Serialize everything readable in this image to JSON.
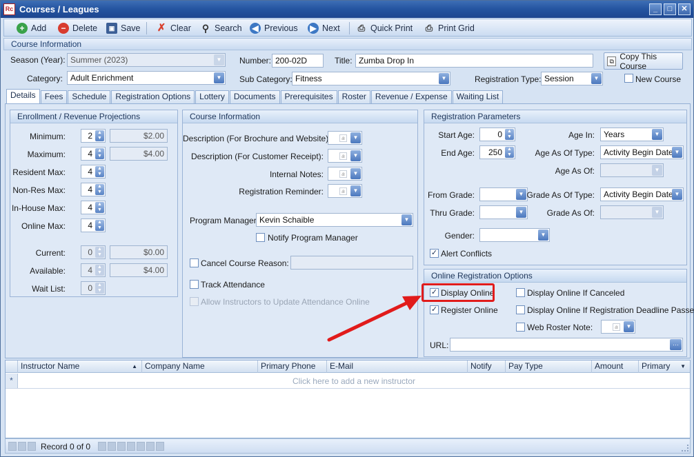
{
  "window": {
    "app_icon_text": "Rc",
    "title": "Courses / Leagues",
    "min": "_",
    "max": "□",
    "close": "✕"
  },
  "toolbar": {
    "add": "Add",
    "delete": "Delete",
    "save": "Save",
    "clear": "Clear",
    "search": "Search",
    "previous": "Previous",
    "next": "Next",
    "quick_print": "Quick Print",
    "print_grid": "Print Grid"
  },
  "course_info_header": "Course Information",
  "header_fields": {
    "season_label": "Season (Year):",
    "season_value": "Summer (2023)",
    "number_label": "Number:",
    "number_value": "200-02D",
    "title_label": "Title:",
    "title_value": "Zumba Drop In",
    "copy_button": "Copy This Course",
    "category_label": "Category:",
    "category_value": "Adult Enrichment",
    "subcategory_label": "Sub Category:",
    "subcategory_value": "Fitness",
    "regtype_label": "Registration Type:",
    "regtype_value": "Session",
    "new_course_label": "New Course"
  },
  "tabs": [
    "Details",
    "Fees",
    "Schedule",
    "Registration Options",
    "Lottery",
    "Documents",
    "Prerequisites",
    "Roster",
    "Revenue / Expense",
    "Waiting List"
  ],
  "enrollment": {
    "title": "Enrollment / Revenue Projections",
    "minimum_label": "Minimum:",
    "minimum_value": "2",
    "minimum_amount": "$2.00",
    "maximum_label": "Maximum:",
    "maximum_value": "4",
    "maximum_amount": "$4.00",
    "resident_max_label": "Resident Max:",
    "resident_max_value": "4",
    "nonres_max_label": "Non-Res Max:",
    "nonres_max_value": "4",
    "inhouse_max_label": "In-House Max:",
    "inhouse_max_value": "4",
    "online_max_label": "Online Max:",
    "online_max_value": "4",
    "current_label": "Current:",
    "current_value": "0",
    "current_amount": "$0.00",
    "available_label": "Available:",
    "available_value": "4",
    "available_amount": "$4.00",
    "waitlist_label": "Wait List:",
    "waitlist_value": "0"
  },
  "course_panel": {
    "title": "Course Information",
    "desc_brochure_label": "Description (For Brochure and Website):",
    "desc_receipt_label": "Description (For Customer Receipt):",
    "internal_notes_label": "Internal Notes:",
    "reg_reminder_label": "Registration Reminder:",
    "memo_glyph": "a",
    "program_manager_label": "Program Manager:",
    "program_manager_value": "Kevin Schaible",
    "notify_pm_label": "Notify Program Manager",
    "cancel_course_label": "Cancel Course",
    "reason_label": "Reason:",
    "track_attendance_label": "Track Attendance",
    "allow_instructors_label": "Allow Instructors to Update Attendance Online"
  },
  "reg_params": {
    "title": "Registration Parameters",
    "start_age_label": "Start Age:",
    "start_age_value": "0",
    "end_age_label": "End Age:",
    "end_age_value": "250",
    "age_in_label": "Age In:",
    "age_in_value": "Years",
    "age_as_of_type_label": "Age As Of Type:",
    "age_as_of_type_value": "Activity Begin Date",
    "age_as_of_label": "Age As Of:",
    "from_grade_label": "From Grade:",
    "thru_grade_label": "Thru Grade:",
    "grade_as_of_type_label": "Grade As Of Type:",
    "grade_as_of_type_value": "Activity Begin Date",
    "grade_as_of_label": "Grade As Of:",
    "gender_label": "Gender:",
    "alert_conflicts_label": "Alert Conflicts"
  },
  "online_options": {
    "title": "Online Registration Options",
    "display_online_label": "Display Online",
    "register_online_label": "Register Online",
    "display_if_canceled_label": "Display Online If Canceled",
    "display_if_deadline_label": "Display Online If Registration Deadline Passed",
    "web_roster_label": "Web Roster Note:",
    "url_label": "URL:",
    "ellipsis": "···"
  },
  "grid": {
    "columns": [
      "Instructor Name",
      "Company Name",
      "Primary Phone",
      "E-Mail",
      "Notify",
      "Pay Type",
      "Amount",
      "Primary"
    ],
    "new_row_marker": "*",
    "add_row_text": "Click here to add a new instructor"
  },
  "statusbar": {
    "record_text": "Record 0 of 0"
  },
  "colors": {
    "highlight_box": "#e11b1b",
    "arrow": "#e11b1b",
    "title_bar": "#2454a0"
  }
}
